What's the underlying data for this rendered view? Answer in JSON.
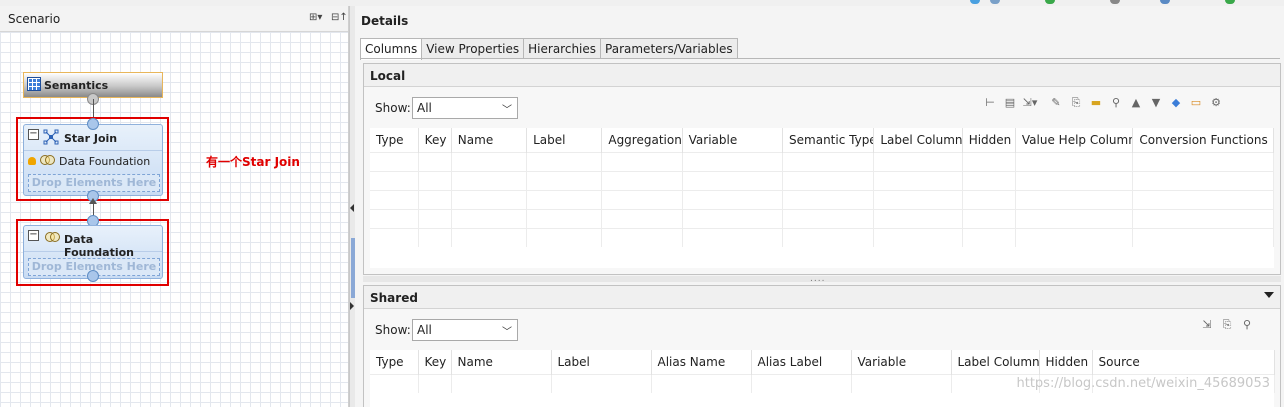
{
  "scenario_panel": {
    "title": "Scenario",
    "toolbar": [
      "expand-all-icon",
      "collapse-all-icon"
    ]
  },
  "nodes": {
    "semantics": "Semantics",
    "star_join": {
      "title": "Star Join",
      "child": "Data Foundation",
      "drop_hint": "Drop Elements Here"
    },
    "data_foundation": {
      "title": "Data Foundation",
      "drop_hint": "Drop Elements Here"
    }
  },
  "annotation": "有一个Star Join",
  "details": {
    "title": "Details",
    "tabs": [
      "Columns",
      "View Properties",
      "Hierarchies",
      "Parameters/Variables"
    ],
    "active_tab": "Columns",
    "local": {
      "title": "Local",
      "show_label": "Show:",
      "show_value": "All",
      "columns": [
        "Type",
        "Key",
        "Name",
        "Label",
        "Aggregation",
        "Variable",
        "Semantic Type",
        "Label Column",
        "Hidden",
        "Value Help Column",
        "Conversion Functions"
      ]
    },
    "shared": {
      "title": "Shared",
      "show_label": "Show:",
      "show_value": "All",
      "columns": [
        "Type",
        "Key",
        "Name",
        "Label",
        "Alias Name",
        "Alias Label",
        "Variable",
        "Label Column",
        "Hidden",
        "Source"
      ]
    }
  },
  "watermark": "https://blog.csdn.net/weixin_45689053",
  "colors": {
    "annotation": "#e00000",
    "node_fill": "#c9dcf3",
    "semantics_border": "#e8b65a"
  }
}
